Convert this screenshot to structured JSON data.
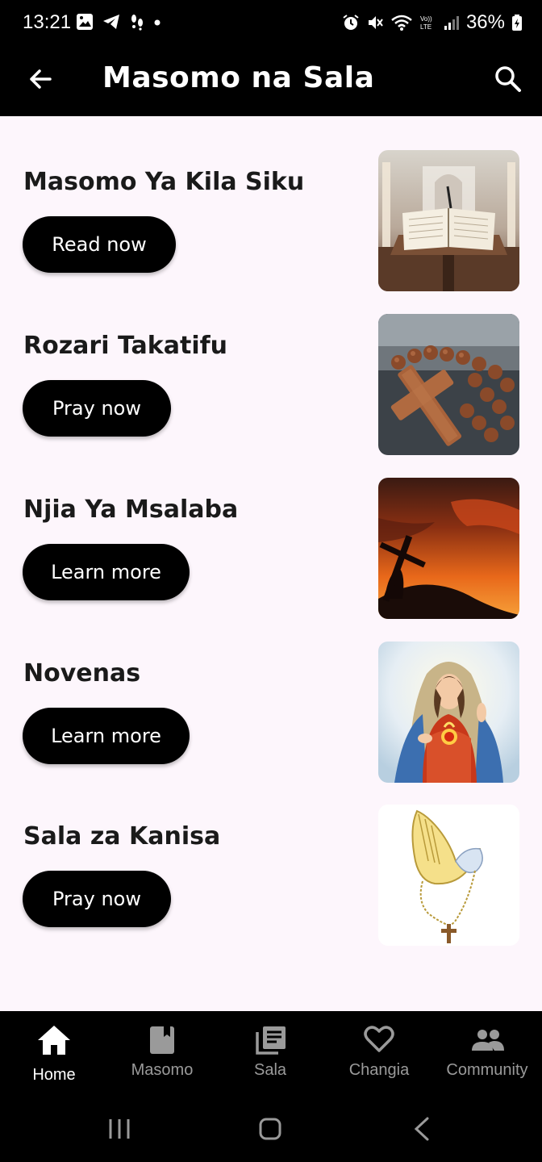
{
  "status_bar": {
    "time": "13:21",
    "battery": "36%"
  },
  "app_bar": {
    "title": "Masomo na Sala"
  },
  "cards": [
    {
      "title": "Masomo Ya Kila Siku",
      "button": "Read now",
      "image": "open-bible-on-lectern"
    },
    {
      "title": "Rozari Takatifu",
      "button": "Pray now",
      "image": "rosary-with-wooden-cross"
    },
    {
      "title": "Njia Ya Msalaba",
      "button": "Learn more",
      "image": "cross-silhouette-at-sunset"
    },
    {
      "title": "Novenas",
      "button": "Learn more",
      "image": "virgin-mary-immaculate-heart"
    },
    {
      "title": "Sala za Kanisa",
      "button": "Pray now",
      "image": "praying-hands-with-rosary"
    }
  ],
  "bottom_nav": {
    "items": [
      {
        "label": "Home",
        "icon": "home-icon",
        "active": true
      },
      {
        "label": "Masomo",
        "icon": "book-icon",
        "active": false
      },
      {
        "label": "Sala",
        "icon": "library-books-icon",
        "active": false
      },
      {
        "label": "Changia",
        "icon": "heart-icon",
        "active": false
      },
      {
        "label": "Community",
        "icon": "people-icon",
        "active": false
      }
    ]
  },
  "colors": {
    "app_bar": "#000000",
    "background": "#fdf6fc",
    "button": "#000000",
    "nav_active": "#ffffff",
    "nav_inactive": "#9a9a9a"
  }
}
